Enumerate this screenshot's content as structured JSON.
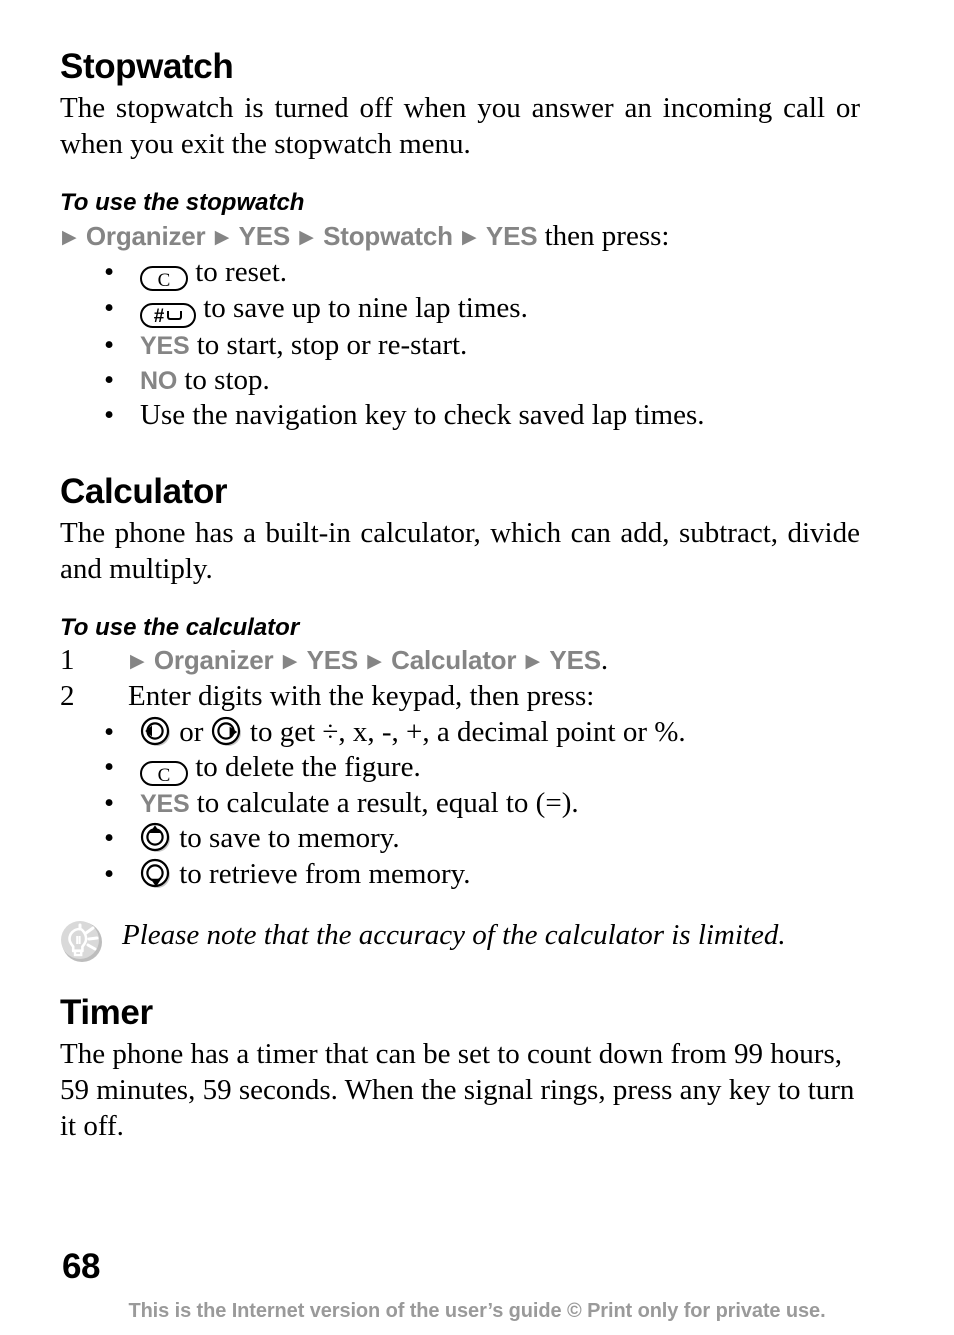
{
  "page": {
    "number": "68",
    "footer_note": "This is the Internet version of the user’s guide © Print only for private use."
  },
  "sections": [
    {
      "id": "stopwatch",
      "title": "Stopwatch",
      "intro": "The stopwatch is turned off when you answer an incoming call or when you exit the stopwatch menu.",
      "subheading": "To use the stopwatch",
      "menu_path": {
        "items": [
          "Organizer",
          "YES",
          "Stopwatch",
          "YES"
        ],
        "separator": "▶",
        "tail": " then press:"
      },
      "bullets": [
        {
          "icon": "c-key-icon",
          "icon_label": "C",
          "text": " to reset."
        },
        {
          "icon": "hash-key-icon",
          "icon_label": "#",
          "text": " to save up to nine lap times."
        },
        {
          "icon": "yes-key-label",
          "icon_label": "YES",
          "text": " to start, stop or re-start."
        },
        {
          "icon": "no-key-label",
          "icon_label": "NO",
          "text": " to stop."
        },
        {
          "icon": "none",
          "icon_label": "",
          "text": "Use the navigation key to check saved lap times."
        }
      ]
    },
    {
      "id": "calculator",
      "title": "Calculator",
      "intro": "The phone has a built-in calculator, which can add, subtract, divide and multiply.",
      "subheading": "To use the calculator",
      "steps": [
        {
          "number": "1",
          "menu_path": {
            "items": [
              "Organizer",
              "YES",
              "Calculator",
              "YES"
            ],
            "separator": "▶",
            "tail": "."
          }
        },
        {
          "number": "2",
          "text": "Enter digits with the keypad, then press:"
        }
      ],
      "bullets": [
        {
          "icon": "nav-key-left-icon",
          "mid": " or ",
          "icon2": "nav-key-right-icon",
          "text": " to get ÷, x, -, +, a decimal point or %."
        },
        {
          "icon": "c-key-icon",
          "icon_label": "C",
          "text": " to delete the figure."
        },
        {
          "icon": "yes-key-label",
          "icon_label": "YES",
          "text": " to calculate a result, equal to (=)."
        },
        {
          "icon": "nav-key-up-icon",
          "icon_label": "",
          "text": " to save to memory."
        },
        {
          "icon": "nav-key-down-icon",
          "icon_label": "",
          "text": " to retrieve from memory."
        }
      ],
      "note": {
        "icon": "tip-lightbulb-icon",
        "text": "Please note that the accuracy of the calculator is limited."
      }
    },
    {
      "id": "timer",
      "title": "Timer",
      "intro": "The phone has a timer that can be set to count down from 99 hours, 59 minutes, 59 seconds. When the signal rings, press any key to turn it off."
    }
  ],
  "colors": {
    "menu_gray": "#858585",
    "footer_gray": "#9a9a9a",
    "text_black": "#000000"
  }
}
